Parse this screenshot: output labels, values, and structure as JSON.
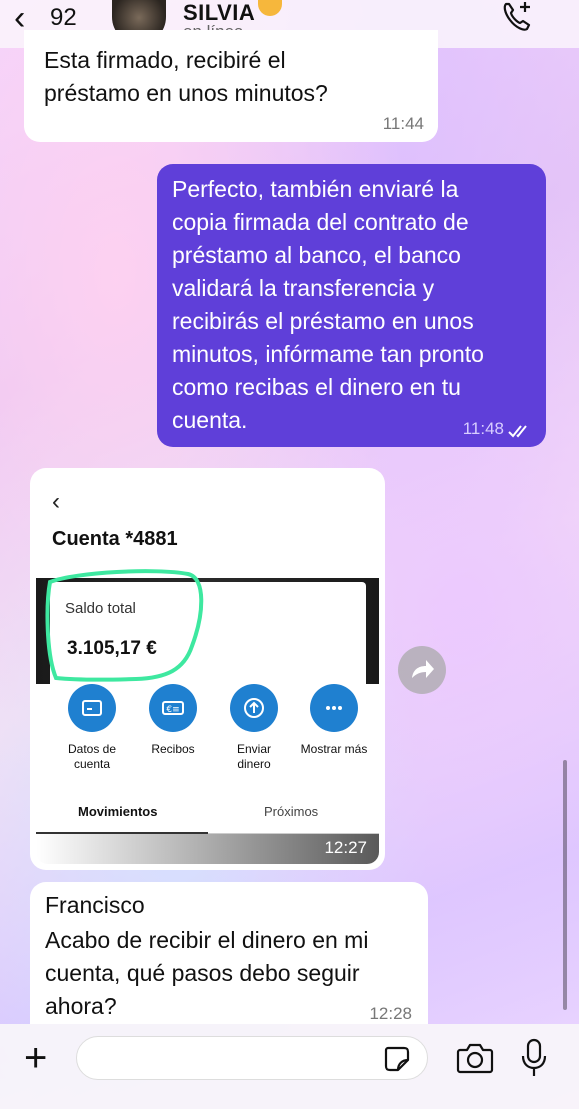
{
  "header": {
    "back_icon": "chevron-left",
    "unread_count": "92",
    "contact_name": "SILVIA",
    "contact_status": "en línea",
    "call_icon": "phone-plus"
  },
  "messages": [
    {
      "direction": "in",
      "text": "Esta firmado, recibiré el\npréstamo en unos minutos?",
      "time": "11:44"
    },
    {
      "direction": "out",
      "text": "Perfecto, también enviaré la\ncopia firmada del contrato de\npréstamo al banco, el banco\nvalidará la transferencia y\nrecibirás el préstamo en unos\nminutos, infórmame tan pronto\ncomo recibas el dinero en tu\ncuenta.",
      "time": "11:48",
      "read_icon": "double-check"
    },
    {
      "direction": "in",
      "type": "image",
      "time": "12:27",
      "screenshot": {
        "account": "Cuenta *4881",
        "balance_label": "Saldo total",
        "balance": "3.105,17 €",
        "actions": [
          "Datos de\ncuenta",
          "Recibos",
          "Enviar\ndinero",
          "Mostrar más"
        ],
        "tabs": [
          "Movimientos",
          "Próximos"
        ]
      }
    },
    {
      "direction": "in",
      "sender": "Francisco",
      "text": "Acabo de recibir el dinero en mi\ncuenta, qué pasos debo seguir\nahora?",
      "time": "12:28"
    }
  ],
  "input_bar": {
    "placeholder": "",
    "icons": [
      "plus-icon",
      "sticker-icon",
      "camera-icon",
      "mic-icon"
    ]
  },
  "colors": {
    "outgoing_bubble": "#5f3fd9",
    "incoming_bubble": "#ffffff",
    "highlight_marker": "#3ee8a0",
    "action_circle": "#1f80d0"
  }
}
